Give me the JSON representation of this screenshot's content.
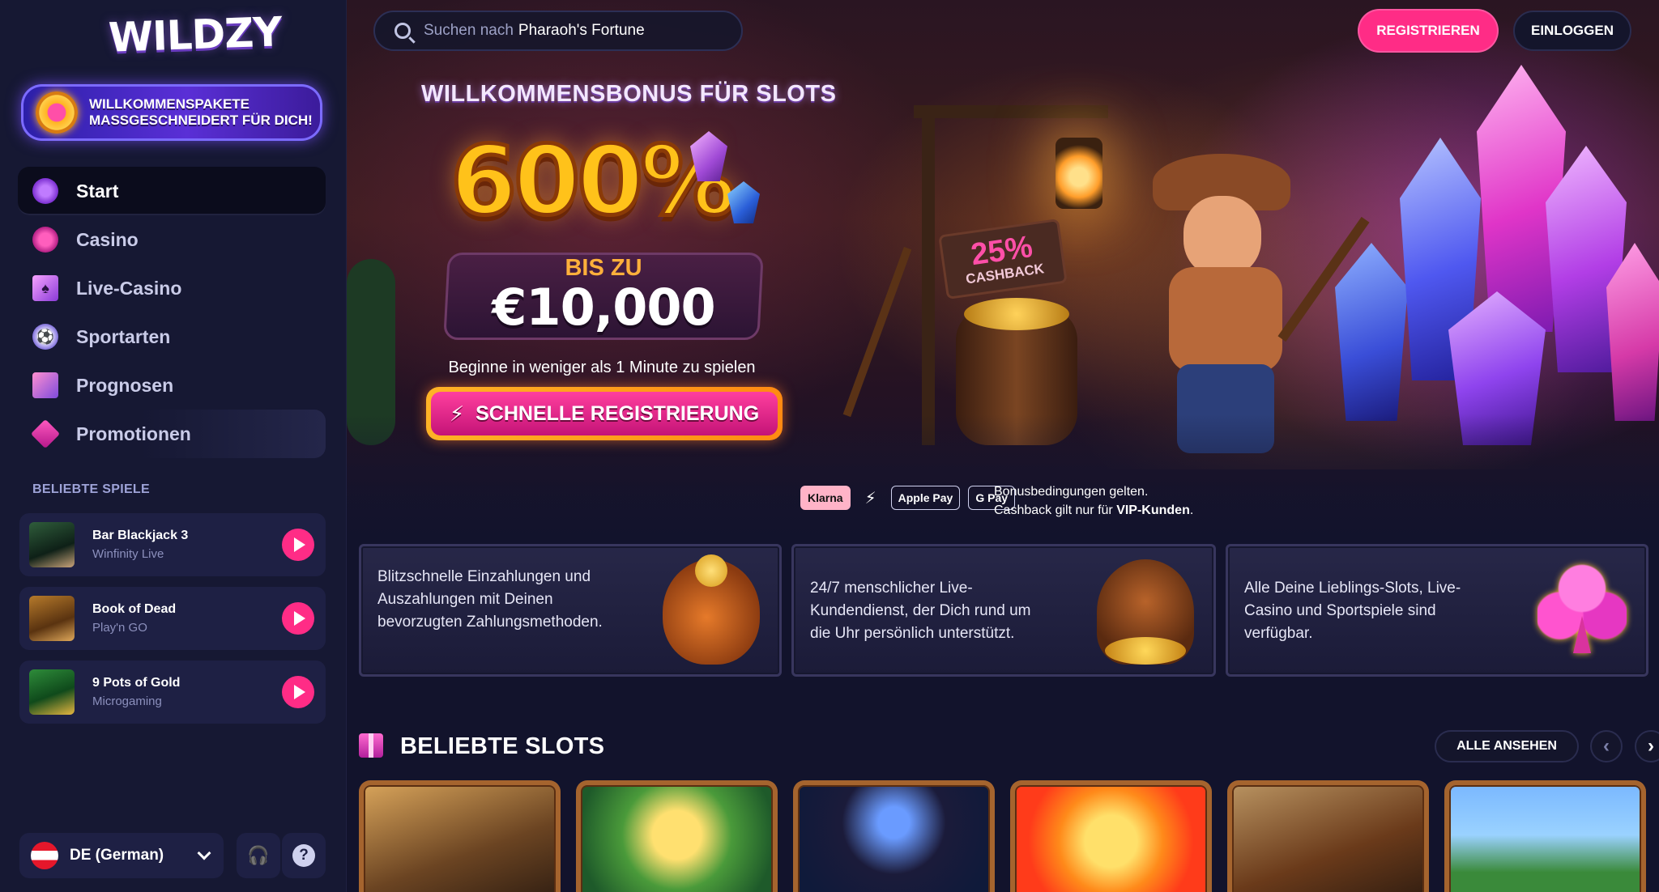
{
  "brand": {
    "logo_text": "WILDZY"
  },
  "sidebar": {
    "promo_banner": "WILLKOMMENSPAKETE MASSGESCHNEIDERT FÜR DICH!",
    "nav": [
      {
        "label": "Start",
        "icon": "start-icon",
        "active": true
      },
      {
        "label": "Casino",
        "icon": "casino-chip-icon"
      },
      {
        "label": "Live-Casino",
        "icon": "playing-cards-icon"
      },
      {
        "label": "Sportarten",
        "icon": "soccer-ball-icon"
      },
      {
        "label": "Prognosen",
        "icon": "prediction-icon"
      },
      {
        "label": "Promotionen",
        "icon": "diamond-icon"
      }
    ],
    "popular_title": "BELIEBTE SPIELE",
    "popular_games": [
      {
        "name": "Bar Blackjack 3",
        "provider": "Winfinity Live"
      },
      {
        "name": "Book of Dead",
        "provider": "Play'n GO"
      },
      {
        "name": "9 Pots of Gold",
        "provider": "Microgaming"
      }
    ],
    "language": "DE (German)"
  },
  "header": {
    "search_prefix": "Suchen nach",
    "search_game": "Pharaoh's Fortune",
    "register": "REGISTRIEREN",
    "login": "EINLOGGEN"
  },
  "hero": {
    "title": "WILLKOMMENSBONUS FÜR SLOTS",
    "percent": "600%",
    "upto": "BIS ZU",
    "amount": "€10,000",
    "subtitle": "Beginne in weniger als 1 Minute zu spielen",
    "cta": "SCHNELLE REGISTRIERUNG",
    "cashback_pct": "25%",
    "cashback_label": "CASHBACK",
    "payments": [
      "Klarna",
      "Apple Pay",
      "G Pay"
    ],
    "note_line1": "Bonusbedingungen gelten.",
    "note_line2_prefix": "Cashback gilt nur für",
    "note_line2_bold": "VIP-Kunden",
    "note_line2_suffix": "."
  },
  "features": [
    {
      "text": "Blitzschnelle Einzahlungen und Auszahlungen mit Deinen bevorzugten Zahlungsmethoden."
    },
    {
      "text": "24/7 menschlicher Live-Kundendienst, der Dich rund um die Uhr persönlich unterstützt."
    },
    {
      "text": "Alle Deine Lieblings-Slots, Live-Casino und Sportspiele sind verfügbar."
    }
  ],
  "slots_section": {
    "title": "BELIEBTE SLOTS",
    "see_all": "ALLE ANSEHEN",
    "prev": "‹",
    "next": "›"
  },
  "colors": {
    "accent": "#ff2c86",
    "sidebar_bg": "#161833",
    "page_bg": "#12132c"
  }
}
